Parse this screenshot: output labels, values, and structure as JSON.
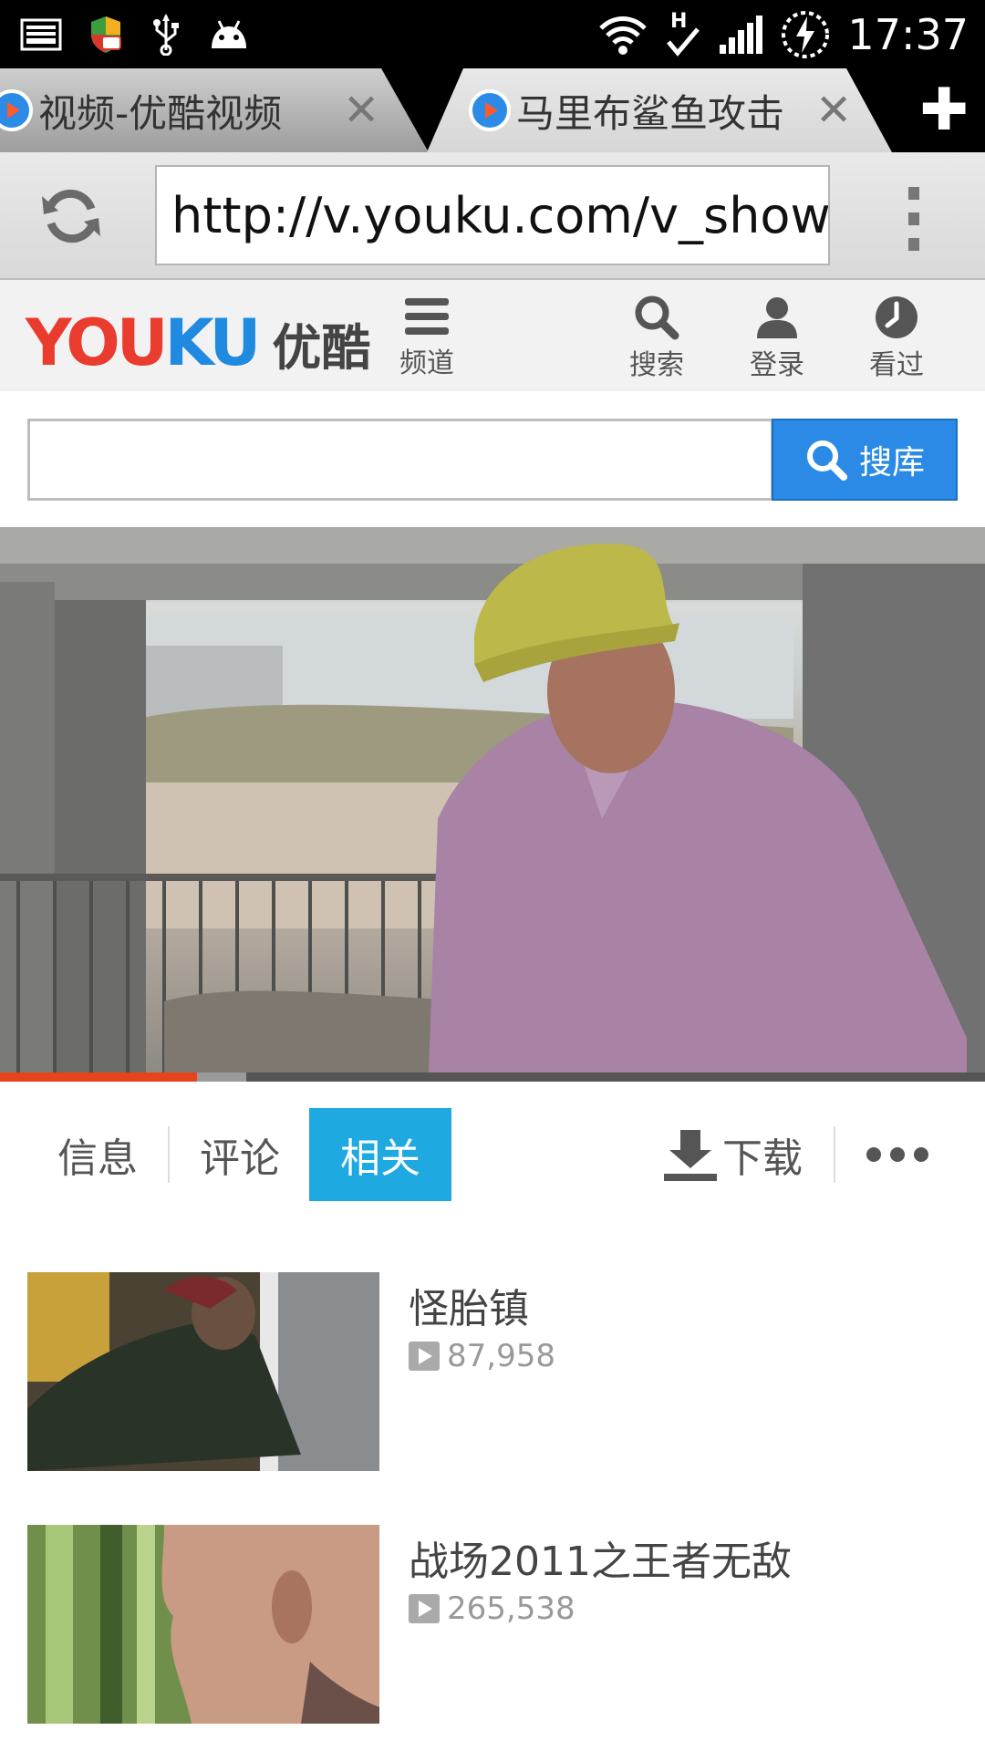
{
  "status_bar": {
    "time": "17:37",
    "icons": [
      "screenshot-icon",
      "security-shield-icon",
      "usb-icon",
      "android-icon",
      "wifi-icon",
      "h-signal-icon",
      "cell-signal-icon",
      "battery-charging-icon"
    ]
  },
  "browser": {
    "tabs": [
      {
        "title": "视频-优酷视频"
      },
      {
        "title": "马里布鲨鱼攻击"
      }
    ],
    "url": "http://v.youku.com/v_show"
  },
  "youku": {
    "logo_you": "YOU",
    "logo_ku": "KU",
    "logo_cn": "优酷",
    "nav": {
      "channel": "频道",
      "search": "搜索",
      "login": "登录",
      "history": "看过"
    },
    "search_button": "搜库",
    "search_placeholder": ""
  },
  "player": {
    "played_fraction": 0.2,
    "buffered_fraction": 0.25
  },
  "detail_tabs": {
    "info": "信息",
    "comments": "评论",
    "related": "相关",
    "download": "下载",
    "active": "相关"
  },
  "related": [
    {
      "title": "怪胎镇",
      "views": "87,958"
    },
    {
      "title": "战场2011之王者无敌",
      "views": "265,538"
    }
  ],
  "colors": {
    "youku_red": "#ea3b2f",
    "youku_blue": "#1f8ae0",
    "tab_active": "#1fa9e1",
    "progress_played": "#e8431d"
  }
}
